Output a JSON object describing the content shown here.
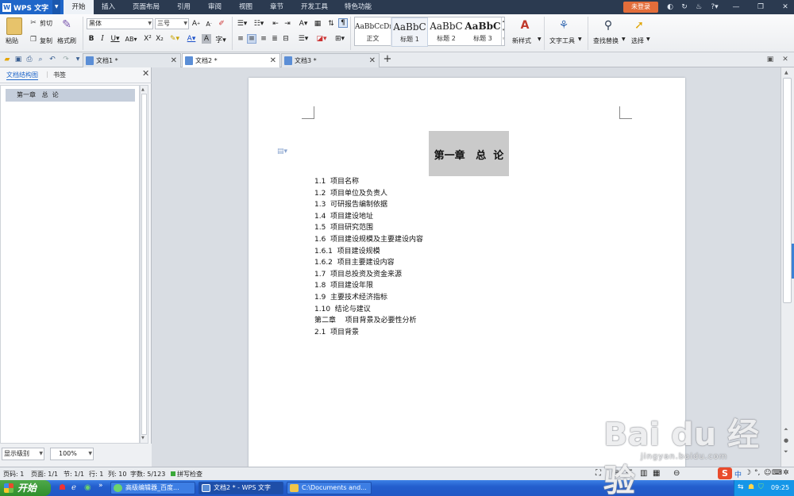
{
  "menubar": {
    "app_name": "WPS 文字",
    "items": [
      "开始",
      "插入",
      "页面布局",
      "引用",
      "审阅",
      "视图",
      "章节",
      "开发工具",
      "特色功能"
    ],
    "login": "未登录"
  },
  "ribbon": {
    "paste": "粘贴",
    "cut": "剪切",
    "copy": "复制",
    "format_painter": "格式刷",
    "font_name": "黑体",
    "font_size": "三号",
    "styles": [
      {
        "preview": "AaBbCcDı",
        "name": "正文"
      },
      {
        "preview": "AaBbC",
        "name": "标题 1"
      },
      {
        "preview": "AaBbC",
        "name": "标题 2"
      },
      {
        "preview": "AaBbC",
        "name": "标题 3"
      }
    ],
    "new_style": "新样式",
    "text_tools": "文字工具",
    "find_replace": "查找替换",
    "select": "选择"
  },
  "tabs": [
    {
      "label": "文档1 *",
      "active": false
    },
    {
      "label": "文档2 *",
      "active": true
    },
    {
      "label": "文档3 *",
      "active": false
    }
  ],
  "leftpanel": {
    "tab_structure": "文档结构图",
    "tab_bookmark": "书签",
    "tree_item": "第一章   总  论",
    "level_select": "显示级别",
    "zoom": "100%"
  },
  "document": {
    "chapter_title": "第一章   总  论",
    "toc": [
      "1.1  项目名称",
      "1.2  项目单位及负责人",
      "1.3  可研报告编制依据",
      "1.4  项目建设地址",
      "1.5  项目研究范围",
      "1.6  项目建设规模及主要建设内容",
      "1.6.1  项目建设规模",
      "1.6.2  项目主要建设内容",
      "1.7  项目总投资及资金来源",
      "1.8  项目建设年限",
      "1.9  主要技术经济指标",
      "1.10  结论与建议",
      "第二章    项目背景及必要性分析",
      "2.1  项目背景"
    ]
  },
  "statusbar": {
    "page_code": "页码: 1",
    "pages": "页面: 1/1",
    "section": "节: 1/1",
    "row": "行: 1",
    "col": "列: 10",
    "word_count": "字数: 5/123",
    "spell_check": "拼写检查"
  },
  "taskbar": {
    "start": "开始",
    "buttons": [
      "高级编辑器_百度...",
      "文档2 * - WPS 文字",
      "C:\\Documents and..."
    ],
    "clock": "09:25"
  },
  "watermark": {
    "logo": "Bai du 经验",
    "url": "jingyan.baidu.com"
  }
}
